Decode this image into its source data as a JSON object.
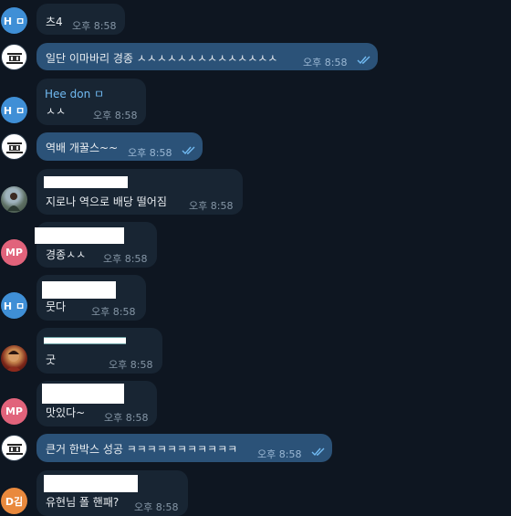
{
  "chat": {
    "messages": [
      {
        "kind": "in",
        "avatar": "H ㅁ",
        "sender": "",
        "text": "츠4",
        "time": "오후 8:58"
      },
      {
        "kind": "out",
        "avatar": "logo-avatar",
        "sender": "",
        "text": "일단 이마바리 경종 ㅅㅅㅅㅅㅅㅅㅅㅅㅅㅅㅅㅅㅅㅅ",
        "time": "오후 8:58",
        "read": true
      },
      {
        "kind": "in",
        "avatar": "H ㅁ",
        "sender": "Hee don ㅁ",
        "text": "ㅅㅅ",
        "time": "오후 8:58"
      },
      {
        "kind": "out",
        "avatar": "logo-avatar",
        "sender": "",
        "text": "역배 개꿀스~~",
        "time": "오후 8:58",
        "read": true
      },
      {
        "kind": "in",
        "avatar": "photo-avatar",
        "sender": "",
        "text": "지로나 역으로 배당 떨어짐",
        "time": "오후 8:58"
      },
      {
        "kind": "in",
        "avatar": "MP",
        "sender": "",
        "text": "경종ㅅㅅ",
        "time": "오후 8:58"
      },
      {
        "kind": "in",
        "avatar": "H ㅁ",
        "sender": "",
        "text": "뭇다",
        "time": "오후 8:58"
      },
      {
        "kind": "in",
        "avatar": "face-avatar",
        "sender": "",
        "text": "굿",
        "time": "오후 8:58"
      },
      {
        "kind": "in",
        "avatar": "MP",
        "sender": "",
        "text": "맛있다~",
        "time": "오후 8:58"
      },
      {
        "kind": "out",
        "avatar": "logo-avatar",
        "sender": "",
        "text": "큰거 한박스 성공 ㅋㅋㅋㅋㅋㅋㅋㅋㅋㅋㅋ",
        "time": "오후 8:58",
        "read": true
      },
      {
        "kind": "in",
        "avatar": "D김",
        "sender": "",
        "text": "유현님 폴 핸패?",
        "time": "오후 8:58"
      }
    ]
  },
  "colors": {
    "background": "#0e1621",
    "incoming_bubble": "#182533",
    "outgoing_bubble": "#2b5278",
    "sender_name": "#71baf2",
    "read_checks": "#71baf2"
  }
}
